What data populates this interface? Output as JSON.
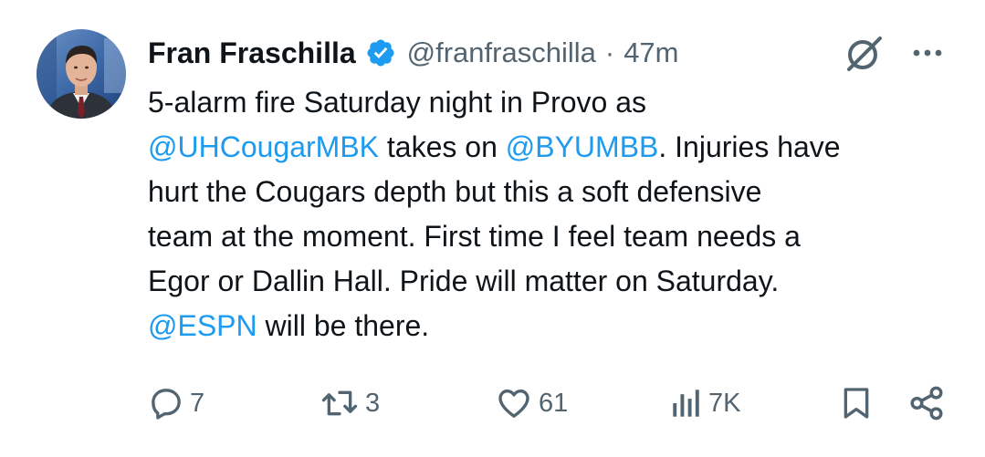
{
  "tweet": {
    "author_name": "Fran Fraschilla",
    "handle": "@franfraschilla",
    "separator": "·",
    "time": "47m",
    "lines": [
      [
        {
          "t": "5-alarm fire Saturday night in Provo as",
          "m": false
        }
      ],
      [
        {
          "t": "@UHCougarMBK",
          "m": true
        },
        {
          "t": " takes on ",
          "m": false
        },
        {
          "t": "@BYUMBB",
          "m": true
        },
        {
          "t": ". Injuries have",
          "m": false
        }
      ],
      [
        {
          "t": "hurt the Cougars depth but this a soft defensive",
          "m": false
        }
      ],
      [
        {
          "t": "team at the moment. First time I feel team needs a",
          "m": false
        }
      ],
      [
        {
          "t": "Egor or Dallin Hall. Pride will matter on Saturday.",
          "m": false
        }
      ],
      [
        {
          "t": "@ESPN",
          "m": true
        },
        {
          "t": " will be there.",
          "m": false
        }
      ]
    ]
  },
  "actions": {
    "replies": "7",
    "reposts": "3",
    "likes": "61",
    "views": "7K"
  },
  "icons": {
    "verified": "verified-badge-icon",
    "grok": "grok-icon",
    "more": "more-options-icon",
    "reply": "reply-icon",
    "repost": "repost-icon",
    "like": "heart-icon",
    "views": "views-chart-icon",
    "bookmark": "bookmark-icon",
    "share": "share-icon"
  },
  "colors": {
    "link": "#1d9bf0",
    "secondary_text": "#536471",
    "primary_text": "#0f1419",
    "verified": "#1d9bf0"
  }
}
